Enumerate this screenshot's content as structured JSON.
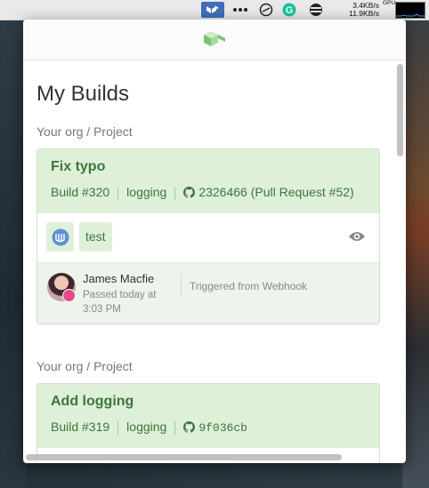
{
  "menubar": {
    "net_up": "3.4KB/s",
    "net_down": "11.9KB/s",
    "vertical_label": "GPU"
  },
  "page": {
    "title": "My Builds"
  },
  "builds": [
    {
      "org_path": "Your org / Project",
      "title": "Fix typo",
      "build_number": "Build #320",
      "branch": "logging",
      "commit": "2326466 (Pull Request #52)",
      "job_label": "test",
      "author": "James Macfie",
      "passed_line1": "Passed today at",
      "passed_line2": "3:03 PM",
      "trigger": "Triggered from Webhook"
    },
    {
      "org_path": "Your org / Project",
      "title": "Add logging",
      "build_number": "Build #319",
      "branch": "logging",
      "commit": "9f036cb"
    }
  ],
  "colors": {
    "success_bg": "#dff0d8",
    "success_text": "#3c763d",
    "brand_green": "#7ac46e"
  }
}
